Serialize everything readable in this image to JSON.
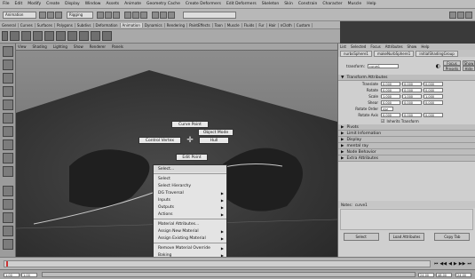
{
  "menubar": [
    "File",
    "Edit",
    "Modify",
    "Create",
    "Display",
    "Window",
    "Assets",
    "Animate",
    "Geometry Cache",
    "Create Deformers",
    "Edit Deformers",
    "Skeleton",
    "Skin",
    "Constrain",
    "Character",
    "Muscle",
    "Help"
  ],
  "toolbar": {
    "mode": "Animation",
    "field": "Rigging"
  },
  "shelf_tabs": [
    "General",
    "Curves",
    "Surfaces",
    "Polygons",
    "Subdivs",
    "Deformation",
    "Animation",
    "Dynamics",
    "Rendering",
    "PaintEffects",
    "Toon",
    "Muscle",
    "Fluids",
    "Fur",
    "Hair",
    "nCloth",
    "Custom"
  ],
  "viewport_menu": [
    "View",
    "Shading",
    "Lighting",
    "Show",
    "Renderer",
    "Panels"
  ],
  "hotbox": {
    "top": "Curve Point",
    "upper_right": "Object Mode",
    "left": "Control Vertex",
    "right": "Hull",
    "bottom": "Edit Point"
  },
  "context_menu": {
    "header": "Select...",
    "items": [
      {
        "label": "Select",
        "sub": false
      },
      {
        "label": "Select Hierarchy",
        "sub": false
      },
      {
        "label": "DG Traversal",
        "sub": true
      },
      {
        "label": "Inputs",
        "sub": true
      },
      {
        "label": "Outputs",
        "sub": true
      },
      {
        "label": "Actions",
        "sub": true
      },
      {
        "label": "Material Attributes...",
        "sub": false
      },
      {
        "label": "Assign New Material",
        "sub": true
      },
      {
        "label": "Assign Existing Material",
        "sub": true
      },
      {
        "label": "Remove Material Override",
        "sub": true
      },
      {
        "label": "Baking",
        "sub": true
      }
    ]
  },
  "channel_box": {
    "menu": [
      "List",
      "Selected",
      "Focus",
      "Attributes",
      "Show",
      "Help"
    ],
    "tabs": [
      "nurbsSphere1",
      "makeNurbSphere1",
      "initialShadingGroup"
    ],
    "transform_label": "transform:",
    "transform_value": "curve1",
    "focus_btn": "Focus",
    "presets_btn": "Presets",
    "show_btn": "Show",
    "hide_btn": "Hide",
    "section_transform": "Transform Attributes",
    "attrs": [
      {
        "label": "Translate",
        "values": [
          "0.000",
          "0.000",
          "0.000"
        ]
      },
      {
        "label": "Rotate",
        "values": [
          "0.000",
          "0.000",
          "0.000"
        ]
      },
      {
        "label": "Scale",
        "values": [
          "1.000",
          "1.000",
          "1.000"
        ]
      },
      {
        "label": "Shear",
        "values": [
          "0.000",
          "0.000",
          "0.000"
        ]
      }
    ],
    "rotate_order_label": "Rotate Order",
    "rotate_order_value": "xyz",
    "rotate_axis_label": "Rotate Axis",
    "rotate_axis_values": [
      "0.000",
      "0.000",
      "0.000"
    ],
    "inherits_label": "Inherits Transform",
    "sections": [
      "Pivots",
      "Limit Information",
      "Display",
      "mental ray",
      "Node Behavior",
      "Extra Attributes"
    ],
    "notes_label": "Notes:",
    "notes_value": "curve1",
    "bottom_buttons": [
      "Select",
      "Load Attributes",
      "Copy Tab"
    ]
  },
  "timeline": {
    "start": "1.00",
    "end": "24.00",
    "range_start": "1.00",
    "range_end": "24.00",
    "anim_end": "48.00"
  },
  "colors": {
    "accent": "#cc3333"
  }
}
